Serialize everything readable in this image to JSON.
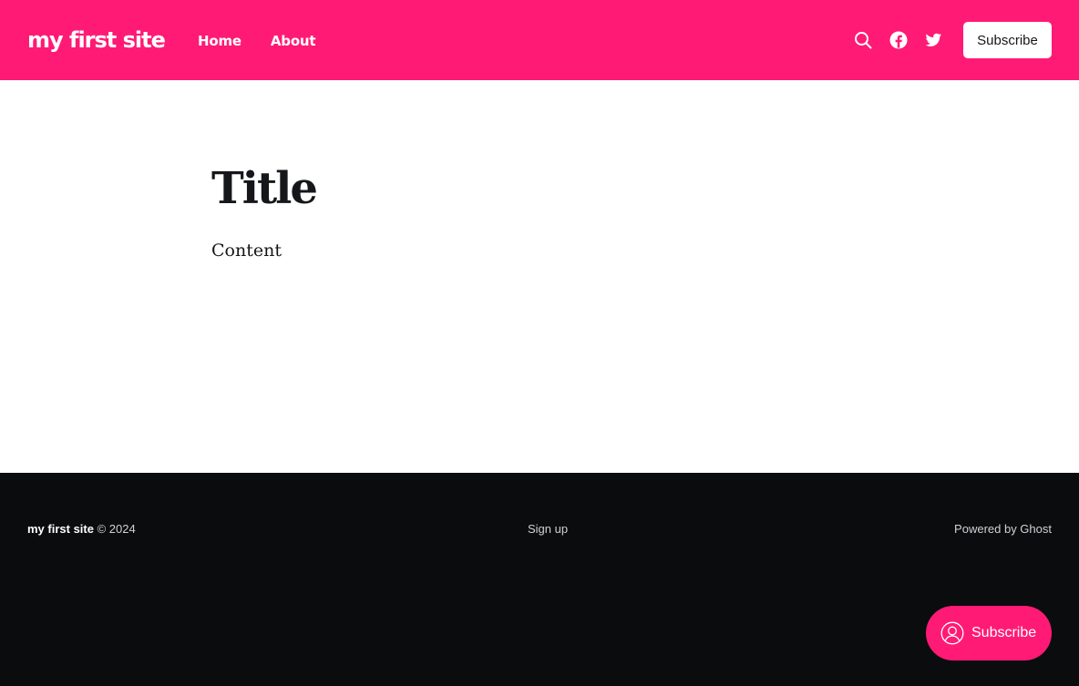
{
  "header": {
    "site_title": "my first site",
    "nav": [
      {
        "label": "Home"
      },
      {
        "label": "About"
      }
    ],
    "icons": [
      "search-icon",
      "facebook-icon",
      "twitter-icon"
    ],
    "subscribe_label": "Subscribe",
    "accent_color": "#ff1a75"
  },
  "main": {
    "title": "Title",
    "content": "Content"
  },
  "footer": {
    "site_title": "my first site",
    "copyright": "© 2024",
    "signup_label": "Sign up",
    "powered_by": "Powered by Ghost",
    "background_color": "#0b0c0e"
  },
  "portal": {
    "label": "Subscribe",
    "icon": "user-circle-icon"
  }
}
